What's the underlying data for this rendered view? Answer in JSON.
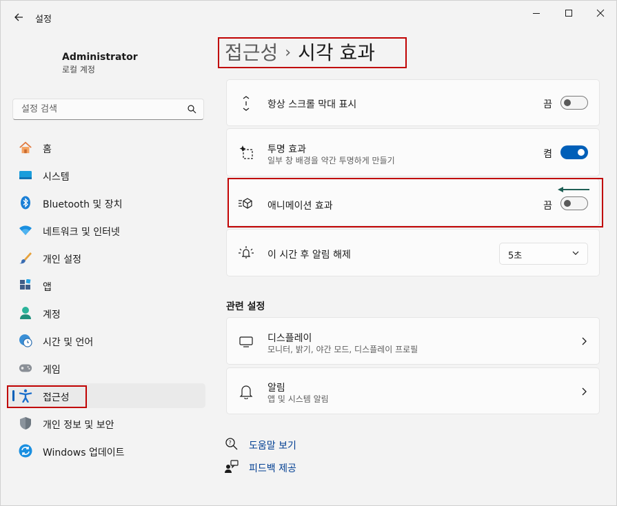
{
  "window": {
    "app_title": "설정",
    "controls": {
      "minimize": "minimize-icon",
      "maximize": "maximize-icon",
      "close": "close-icon"
    }
  },
  "user": {
    "name": "Administrator",
    "account_type": "로컬 계정"
  },
  "search": {
    "placeholder": "설정 검색"
  },
  "sidebar": {
    "items": [
      {
        "label": "홈",
        "icon": "home-icon"
      },
      {
        "label": "시스템",
        "icon": "system-icon"
      },
      {
        "label": "Bluetooth 및 장치",
        "icon": "bluetooth-icon"
      },
      {
        "label": "네트워크 및 인터넷",
        "icon": "wifi-icon"
      },
      {
        "label": "개인 설정",
        "icon": "brush-icon"
      },
      {
        "label": "앱",
        "icon": "apps-icon"
      },
      {
        "label": "계정",
        "icon": "account-icon"
      },
      {
        "label": "시간 및 언어",
        "icon": "clock-globe-icon"
      },
      {
        "label": "게임",
        "icon": "gamepad-icon"
      },
      {
        "label": "접근성",
        "icon": "accessibility-icon",
        "active": true
      },
      {
        "label": "개인 정보 및 보안",
        "icon": "shield-icon"
      },
      {
        "label": "Windows 업데이트",
        "icon": "update-icon"
      }
    ]
  },
  "breadcrumb": {
    "parent": "접근성",
    "separator": "›",
    "current": "시각 효과"
  },
  "settings": [
    {
      "title": "항상 스크롤 막대 표시",
      "state": "끔",
      "toggle_on": false,
      "icon": "scrollbar-icon"
    },
    {
      "title": "투명 효과",
      "description": "일부 창 배경을 약간 투명하게 만들기",
      "state": "켬",
      "toggle_on": true,
      "icon": "transparency-icon"
    },
    {
      "title": "애니메이션 효과",
      "state": "끔",
      "toggle_on": false,
      "icon": "animation-icon"
    },
    {
      "title": "이 시간 후 알림 해제",
      "dropdown_value": "5초",
      "icon": "notification-timer-icon"
    }
  ],
  "related": {
    "section_title": "관련 설정",
    "items": [
      {
        "title": "디스플레이",
        "description": "모니터, 밝기, 야간 모드, 디스플레이 프로필",
        "icon": "monitor-icon"
      },
      {
        "title": "알림",
        "description": "앱 및 시스템 알림",
        "icon": "bell-icon"
      }
    ]
  },
  "links": [
    {
      "label": "도움말 보기",
      "icon": "help-icon"
    },
    {
      "label": "피드백 제공",
      "icon": "feedback-icon"
    }
  ],
  "colors": {
    "accent": "#005fb8",
    "highlight_box": "#c00000",
    "annotation_arrow": "#1e5f55"
  }
}
